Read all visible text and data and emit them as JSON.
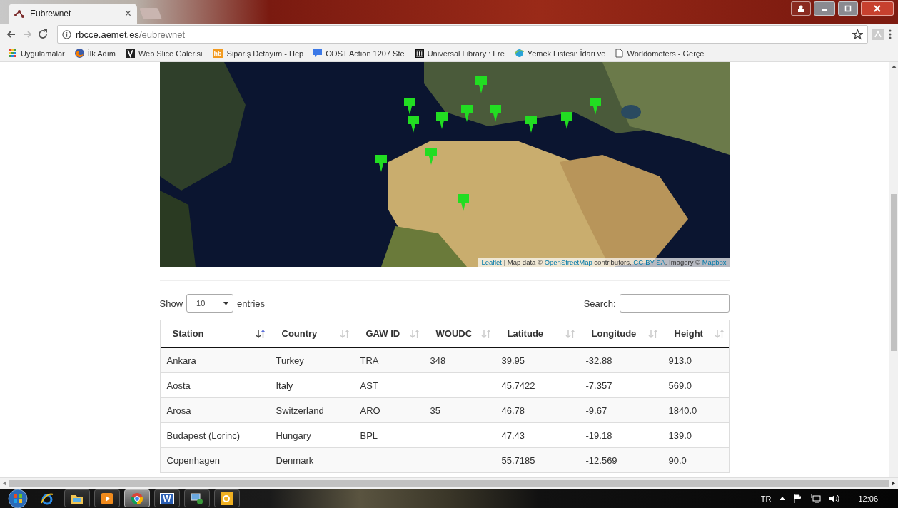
{
  "browser": {
    "tab_title": "Eubrewnet",
    "tab_close": "×",
    "url_host": "rbcce.aemet.es",
    "url_path": "/eubrewnet"
  },
  "bookmarks": [
    {
      "label": "Uygulamalar",
      "kind": "apps"
    },
    {
      "label": "İlk Adım",
      "kind": "firefox"
    },
    {
      "label": "Web Slice Galerisi",
      "kind": "slice"
    },
    {
      "label": "Sipariş Detayım - Hep",
      "kind": "badge",
      "badge": "hb"
    },
    {
      "label": "COST Action 1207 Ste",
      "kind": "chat"
    },
    {
      "label": "Universal Library : Fre",
      "kind": "library"
    },
    {
      "label": "Yemek Listesi: İdari ve",
      "kind": "globe"
    },
    {
      "label": "Worldometers - Gerçe",
      "kind": "page"
    }
  ],
  "map": {
    "kind": "picture",
    "attribution": [
      {
        "text": "Leaflet",
        "link": true
      },
      {
        "text": " | Map data © ",
        "link": false
      },
      {
        "text": "OpenStreetMap",
        "link": true
      },
      {
        "text": " contributors, ",
        "link": false
      },
      {
        "text": "CC-BY-SA",
        "link": true
      },
      {
        "text": ", Imagery © ",
        "link": false
      },
      {
        "text": "Mapbox",
        "link": true
      }
    ]
  },
  "length_menu": {
    "before": "Show",
    "value": "10",
    "after": "entries"
  },
  "search": {
    "label": "Search:"
  },
  "table": {
    "columns": [
      {
        "label": "Station",
        "sorted": true
      },
      {
        "label": "Country",
        "sorted": false
      },
      {
        "label": "GAW ID",
        "sorted": false
      },
      {
        "label": "WOUDC",
        "sorted": false
      },
      {
        "label": "Latitude",
        "sorted": false
      },
      {
        "label": "Longitude",
        "sorted": false
      },
      {
        "label": "Height",
        "sorted": false
      }
    ],
    "rows": [
      [
        "Ankara",
        "Turkey",
        "TRA",
        "348",
        "39.95",
        "-32.88",
        "913.0"
      ],
      [
        "Aosta",
        "Italy",
        "AST",
        "",
        "45.7422",
        "-7.357",
        "569.0"
      ],
      [
        "Arosa",
        "Switzerland",
        "ARO",
        "35",
        "46.78",
        "-9.67",
        "1840.0"
      ],
      [
        "Budapest (Lorinc)",
        "Hungary",
        "BPL",
        "",
        "47.43",
        "-19.18",
        "139.0"
      ],
      [
        "Copenhagen",
        "Denmark",
        "",
        "",
        "55.7185",
        "-12.569",
        "90.0"
      ]
    ]
  },
  "taskbar": {
    "apps": [
      {
        "kind": "ie",
        "selected": false
      },
      {
        "kind": "folder",
        "selected": false
      },
      {
        "kind": "media",
        "selected": false
      },
      {
        "kind": "chrome",
        "selected": true
      },
      {
        "kind": "word",
        "selected": false,
        "letter": "W"
      },
      {
        "kind": "network",
        "selected": false
      },
      {
        "kind": "mail",
        "selected": false
      }
    ],
    "language": "TR",
    "clock": "12:06"
  }
}
